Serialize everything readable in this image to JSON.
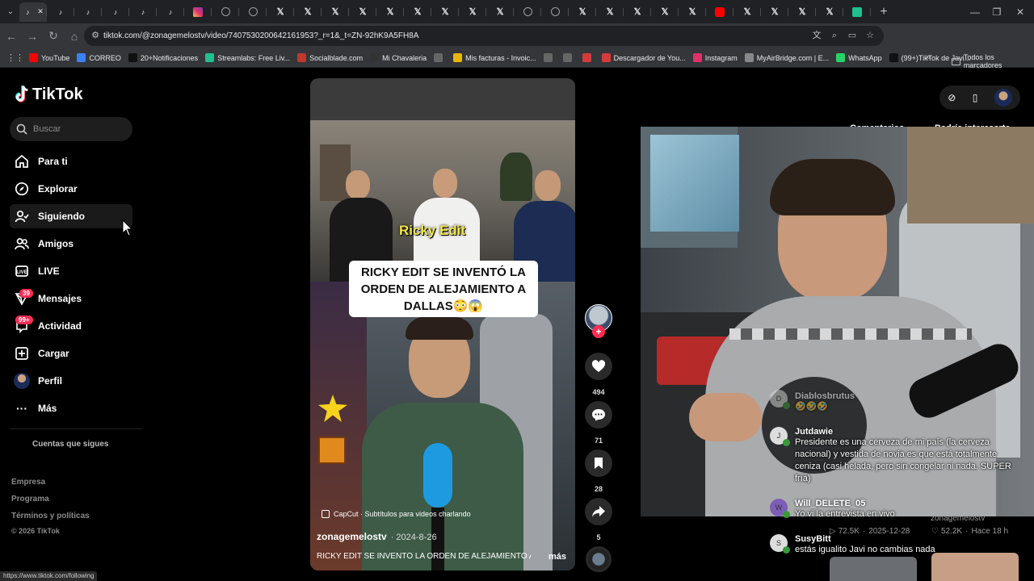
{
  "browser": {
    "tabs": [
      {
        "icon": "tiktok-icon",
        "kind": "tt",
        "glyph": "♪"
      },
      {
        "icon": "tiktok-icon",
        "kind": "tt",
        "glyph": "♪"
      },
      {
        "icon": "tiktok-icon",
        "kind": "tt",
        "glyph": "♪"
      },
      {
        "icon": "tiktok-icon",
        "kind": "tt",
        "glyph": "♪"
      },
      {
        "icon": "tiktok-icon",
        "kind": "tt",
        "glyph": "♪"
      },
      {
        "icon": "tiktok-icon",
        "kind": "tt",
        "glyph": "♪"
      },
      {
        "icon": "instagram-icon",
        "kind": "ig",
        "glyph": ""
      },
      {
        "icon": "globe-icon",
        "kind": "glb",
        "glyph": ""
      },
      {
        "icon": "globe-icon",
        "kind": "glb",
        "glyph": ""
      },
      {
        "icon": "x-icon",
        "kind": "x",
        "glyph": "𝕏"
      },
      {
        "icon": "x-icon",
        "kind": "x",
        "glyph": "𝕏"
      },
      {
        "icon": "x-icon",
        "kind": "x",
        "glyph": "𝕏"
      },
      {
        "icon": "x-icon",
        "kind": "x",
        "glyph": "𝕏"
      },
      {
        "icon": "x-icon",
        "kind": "x",
        "glyph": "𝕏"
      },
      {
        "icon": "x-icon",
        "kind": "x",
        "glyph": "𝕏"
      },
      {
        "icon": "x-icon",
        "kind": "x",
        "glyph": "𝕏"
      },
      {
        "icon": "x-icon",
        "kind": "x",
        "glyph": "𝕏"
      },
      {
        "icon": "x-icon",
        "kind": "x",
        "glyph": "𝕏"
      },
      {
        "icon": "globe-icon",
        "kind": "glb",
        "glyph": ""
      },
      {
        "icon": "globe-icon",
        "kind": "glb",
        "glyph": ""
      },
      {
        "icon": "x-icon",
        "kind": "x",
        "glyph": "𝕏"
      },
      {
        "icon": "x-icon",
        "kind": "x",
        "glyph": "𝕏"
      },
      {
        "icon": "x-icon",
        "kind": "x",
        "glyph": "𝕏"
      },
      {
        "icon": "x-icon",
        "kind": "x",
        "glyph": "𝕏"
      },
      {
        "icon": "x-icon",
        "kind": "x",
        "glyph": "𝕏"
      },
      {
        "icon": "youtube-icon",
        "kind": "yt",
        "glyph": ""
      },
      {
        "icon": "x-icon",
        "kind": "x",
        "glyph": "𝕏"
      },
      {
        "icon": "x-icon",
        "kind": "x",
        "glyph": "𝕏"
      },
      {
        "icon": "x-icon",
        "kind": "x",
        "glyph": "𝕏"
      },
      {
        "icon": "x-icon",
        "kind": "x",
        "glyph": "𝕏"
      },
      {
        "icon": "streamlabs-icon",
        "kind": "st",
        "glyph": ""
      }
    ],
    "active_tab_close": "✕",
    "new_tab": "+",
    "url": "tiktok.com/@zonagemelostv/video/7407530200642161953?_r=1&_t=ZN-92hK9A5FH8A",
    "bookmarks": [
      {
        "label": "YouTube",
        "color": "#ff0000"
      },
      {
        "label": "CORREO",
        "color": "#3b82f6"
      },
      {
        "label": "20+Notificaciones",
        "color": "#111111"
      },
      {
        "label": "Streamlabs: Free Liv...",
        "color": "#1fbf8f"
      },
      {
        "label": "Socialblade.com",
        "color": "#c0392b"
      },
      {
        "label": "Mi Chavaleria",
        "color": "#333333"
      },
      {
        "label": "",
        "color": "#666666"
      },
      {
        "label": "Mis facturas - Invoic...",
        "color": "#e6b800"
      },
      {
        "label": "",
        "color": "#666666"
      },
      {
        "label": "",
        "color": "#666666"
      },
      {
        "label": "",
        "color": "#d63a3a"
      },
      {
        "label": "Descargador de You...",
        "color": "#d63a3a"
      },
      {
        "label": "Instagram",
        "color": "#e1306c"
      },
      {
        "label": "MyAirBridge.com | E...",
        "color": "#888888"
      },
      {
        "label": "WhatsApp",
        "color": "#25d366"
      },
      {
        "label": "(99+)TikTok de Javi...",
        "color": "#111111"
      }
    ],
    "bookmarks_more": "»",
    "all_bookmarks": "Todos los marcadores",
    "status_url": "https://www.tiktok.com/following"
  },
  "tiktok": {
    "logo": "TikTok",
    "search_placeholder": "Buscar",
    "nav": [
      {
        "label": "Para ti",
        "icon": "home-icon"
      },
      {
        "label": "Explorar",
        "icon": "compass-icon"
      },
      {
        "label": "Siguiendo",
        "icon": "following-icon"
      },
      {
        "label": "Amigos",
        "icon": "friends-icon"
      },
      {
        "label": "LIVE",
        "icon": "live-icon"
      },
      {
        "label": "Mensajes",
        "icon": "messages-icon",
        "badge": "39"
      },
      {
        "label": "Actividad",
        "icon": "activity-icon",
        "badge": "99+"
      },
      {
        "label": "Cargar",
        "icon": "upload-icon"
      },
      {
        "label": "Perfil",
        "icon": "profile-avatar"
      },
      {
        "label": "Más",
        "icon": "more-icon"
      }
    ],
    "following_accounts": "Cuentas que sigues",
    "footer": [
      "Empresa",
      "Programa",
      "Términos y políticas",
      "© 2026 TikTok"
    ],
    "video": {
      "overlay_label": "Ricky Edit",
      "caption_lines": [
        "RICKY EDIT SE INVENTÓ LA",
        "ORDEN DE ALEJAMIENTO A",
        "DALLAS😳😱"
      ],
      "capcut": "CapCut · Subtítulos para videos charlando",
      "author": "zonagemelostv",
      "date": "· 2024-8-26",
      "description": "RICKY EDIT SE INVENTÓ LA ORDEN DE ALEJAMIENTO A",
      "more": "más",
      "likes": "494",
      "comments": "71",
      "saves": "28",
      "shares": "5"
    },
    "right_tabs": [
      "Comentarios",
      "Podría interesarte"
    ],
    "bg_videos": [
      {
        "author": "zonagemelostv",
        "views": "72.5K",
        "date": "2025-12-28"
      },
      {
        "views": "52.2K",
        "date": "Hace 18 h"
      }
    ]
  },
  "chat": [
    {
      "user": "Diablosbrutus",
      "text": "🤣🤣🤣"
    },
    {
      "user": "Jutdawie",
      "text": "Presidente es una cerveza de mi país (la cerveza nacional) y vestida de novia es que está totalmente ceniza (casi helada, pero sin congelar ni nada. SUPER fría)"
    },
    {
      "user": "Will_DELETE_05",
      "text": "Yo vi la entrevista en vivo"
    },
    {
      "user": "SusyBitt",
      "text": "estás igualito Javi no cambias nada"
    }
  ]
}
